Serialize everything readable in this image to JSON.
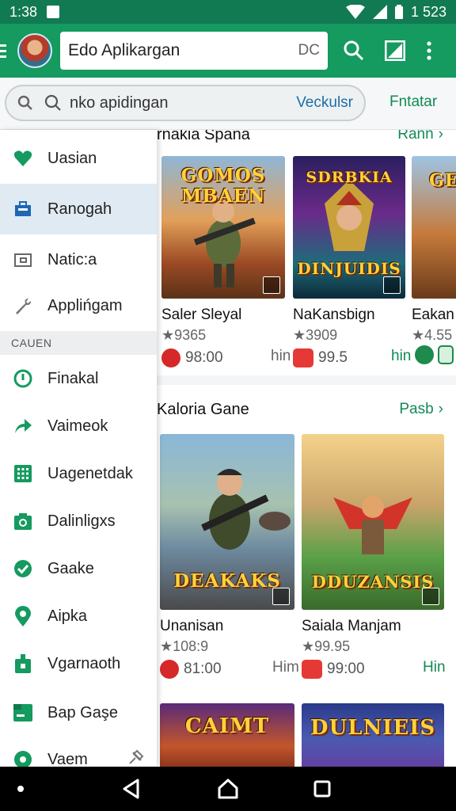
{
  "status_bar": {
    "time": "1:38",
    "battery_text": "1 523"
  },
  "app_bar": {
    "search_value": "Edo Aplikargan",
    "search_suffix": "DC"
  },
  "search_row": {
    "query": "nko apidingan",
    "link": "Veckulsr",
    "filter": "Fntatar"
  },
  "drawer": {
    "items_top": [
      {
        "label": "Uasian",
        "icon": "heart-icon"
      },
      {
        "label": "Ranogah",
        "icon": "briefcase-icon",
        "active": true
      },
      {
        "label": "Natic:a",
        "icon": "folder-icon"
      },
      {
        "label": "Applińgam",
        "icon": "wrench-icon"
      }
    ],
    "section_header": "CAUEN",
    "items_bottom": [
      {
        "label": "Finakal",
        "icon": "info-circle-icon"
      },
      {
        "label": "Vaimeok",
        "icon": "share-arrow-icon"
      },
      {
        "label": "Uagenetdak",
        "icon": "grid-icon"
      },
      {
        "label": "Dalinligxs",
        "icon": "camera-icon"
      },
      {
        "label": "Gaake",
        "icon": "shield-check-icon"
      },
      {
        "label": "Aipka",
        "icon": "location-pin-icon"
      },
      {
        "label": "Vgarnaoth",
        "icon": "bag-icon"
      },
      {
        "label": "Bap Gaşe",
        "icon": "terminal-icon"
      },
      {
        "label": "Vaem",
        "icon": "globe-icon"
      }
    ]
  },
  "sections": [
    {
      "title": "rnakia Spana",
      "more": "Rann",
      "cards": [
        {
          "name": "Saler Sleyal",
          "rating": "★9365",
          "price": "98:00",
          "logo": "GOMOS MBAEN",
          "icon_color": "#d62828"
        },
        {
          "name": "NaKansbign",
          "rating": "★3909",
          "price": "99.5",
          "logo": "SDRBKIA",
          "logo2": "DINJUIDIS",
          "icon_color": "#e53935"
        },
        {
          "name": "Eakan",
          "rating": "★4.55",
          "price": "",
          "logo": "GE",
          "icon_color": "#1e8a4c"
        }
      ],
      "hin_labels": [
        "hin",
        "hin"
      ]
    },
    {
      "title": "Kaloria Gane",
      "more": "Pasb",
      "cards": [
        {
          "name": "Unanisan",
          "rating": "★108:9",
          "price": "81:00",
          "logo": "DEAKAKS",
          "icon_color": "#d62828"
        },
        {
          "name": "Saiala Manjam",
          "rating": "★99.95",
          "price": "99:00",
          "logo": "DDUZANSIS",
          "icon_color": "#e53935"
        }
      ],
      "hin_labels": [
        "Him",
        "Hin"
      ]
    },
    {
      "cards": [
        {
          "logo": "CAIMT"
        },
        {
          "logo": "DULNIEIS"
        }
      ]
    }
  ],
  "colors": {
    "primary": "#159a60",
    "status": "#127a52",
    "accent_green": "#128a55",
    "link_blue": "#1a6fa8"
  }
}
